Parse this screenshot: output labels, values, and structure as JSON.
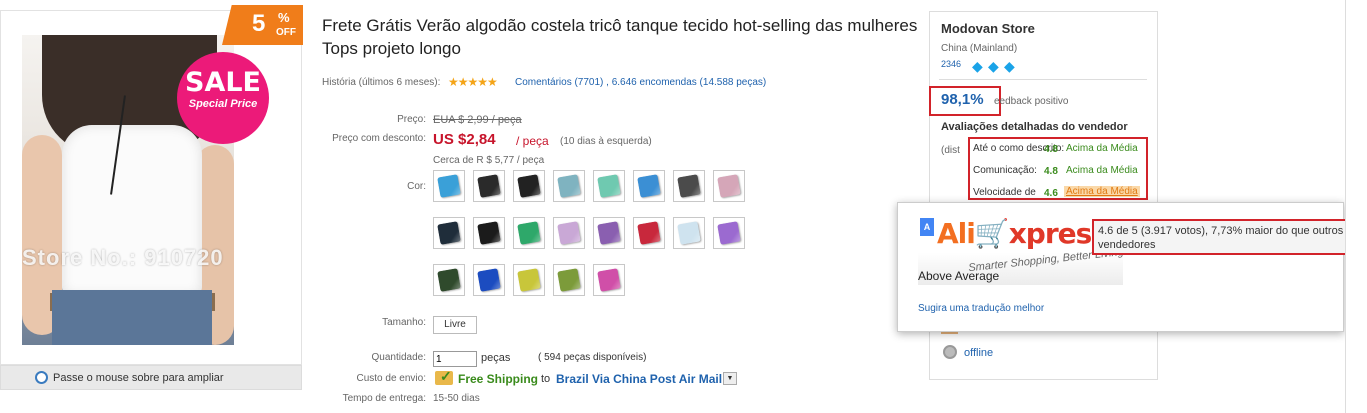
{
  "product": {
    "discount": {
      "number": "5",
      "percent": "%",
      "off": "OFF"
    },
    "sale_badge": {
      "big": "SALE",
      "small": "Special Price"
    },
    "watermark": "Store No.: 910720",
    "zoom_hint": "Passe o mouse sobre para ampliar",
    "title": "Frete Grátis Verão algodão costela tricô tanque tecido hot-selling das mulheres Tops projeto longo",
    "history_label": "História (últimos 6 meses):",
    "stars": "★★★★★",
    "reviews_text": "Comentários (7701) ,  6.646 encomendas (14.588 peças)",
    "price_label": "Preço:",
    "old_price": "EUA $ 2,99 / peça",
    "discount_price_label": "Preço com desconto:",
    "price": "US $2,84",
    "price_unit": "/ peça",
    "price_note": "(10 dias à esquerda)",
    "approx": "Cerca de R $ 5,77 / peça",
    "color_label": "Cor:",
    "colors": [
      "#3aa0d8",
      "#2a2a2a",
      "#222222",
      "#7fb3c0",
      "#6fc9b0",
      "#3b8fd4",
      "#4b4b4b",
      "#d5a6b8",
      "#1f2d3a",
      "#1b1b1b",
      "#2ea86a",
      "#c9a8d6",
      "#8a5fb0",
      "#c8283c",
      "#cfe3ef",
      "#9b6ad0",
      "#2f4a2c",
      "#1c4cc0",
      "#c8c63a",
      "#7c9b3a",
      "#d04fa8"
    ],
    "size_label": "Tamanho:",
    "size_value": "Livre",
    "qty_label": "Quantidade:",
    "qty_value": "1",
    "qty_unit": "peças",
    "qty_available": "( 594 peças disponíveis)",
    "ship_label": "Custo de envio:",
    "free_shipping": "Free Shipping",
    "ship_to": "to",
    "ship_via": "Brazil Via China Post Air Mail",
    "ship_dropdown": "▼",
    "delivery_label": "Tempo de entrega:",
    "delivery_value": "15-50 dias"
  },
  "store": {
    "name": "Modovan Store",
    "country": "China (Mainland)",
    "number": "2346",
    "gems": [
      "◆",
      "◆",
      "◆"
    ],
    "positive_pct": "98,1%",
    "feedback_label": "eedback positivo",
    "ratings_title": "Avaliações detalhadas do vendedor",
    "dist_partial": "(dist",
    "ratings": [
      {
        "label": "Até o como descrito:",
        "score": "4.8",
        "text": "Acima da Média"
      },
      {
        "label": "Comunicação:",
        "score": "4.8",
        "text": "Acima da Média"
      },
      {
        "label": "Velocidade de",
        "score": "4.6",
        "text": "Acima da Média"
      }
    ],
    "status": "offline"
  },
  "translate_popup": {
    "icon": "A",
    "logo_ali": "Ali",
    "logo_express": "xpress",
    "tagline": "Smarter Shopping, Better Living!",
    "translation": "Above Average",
    "suggest": "Sugira uma tradução melhor"
  },
  "tooltip": {
    "text": "4.6 de 5 (3.917 votos), 7,73% maior do que outros vendedores"
  }
}
